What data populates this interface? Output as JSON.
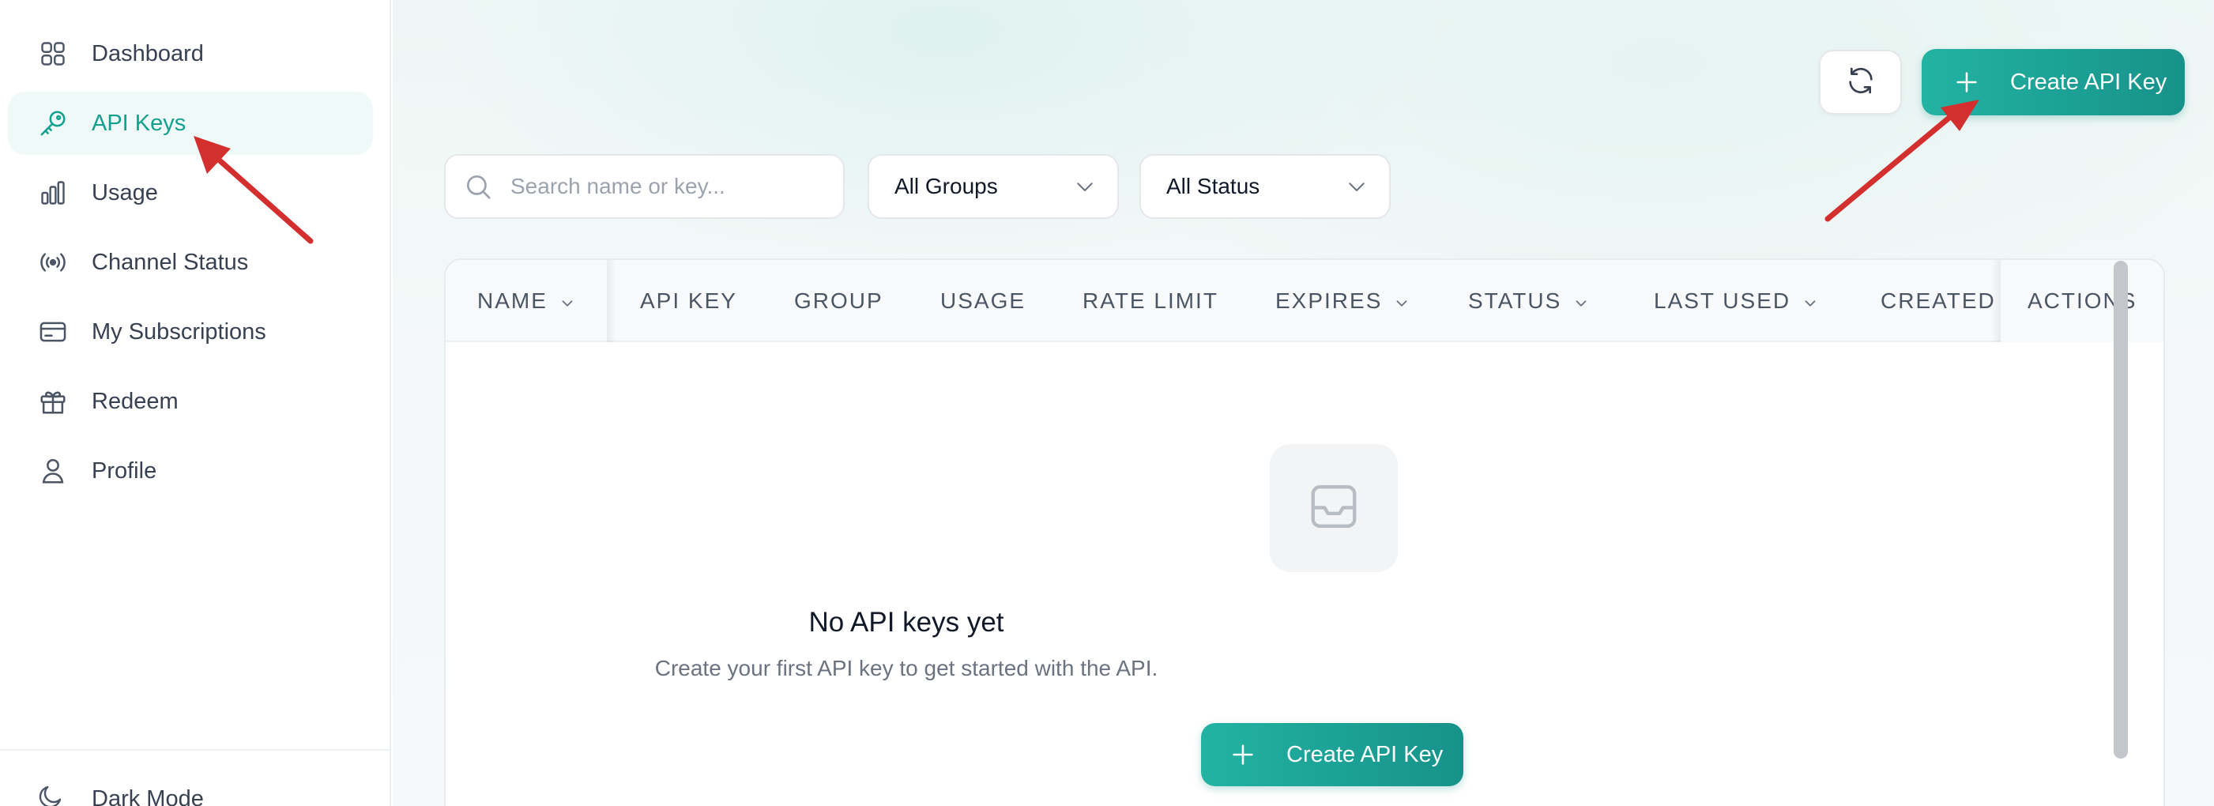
{
  "sidebar": {
    "items": [
      {
        "label": "Dashboard",
        "icon": "grid-icon"
      },
      {
        "label": "API Keys",
        "icon": "key-icon",
        "active": true
      },
      {
        "label": "Usage",
        "icon": "bar-chart-icon"
      },
      {
        "label": "Channel Status",
        "icon": "broadcast-icon"
      },
      {
        "label": "My Subscriptions",
        "icon": "credit-card-icon"
      },
      {
        "label": "Redeem",
        "icon": "gift-icon"
      },
      {
        "label": "Profile",
        "icon": "user-icon"
      }
    ],
    "dark_mode_label": "Dark Mode"
  },
  "toolbar": {
    "create_label": "Create API Key",
    "refresh_icon": "refresh-icon"
  },
  "filters": {
    "search_placeholder": "Search name or key...",
    "group_selected": "All Groups",
    "status_selected": "All Status"
  },
  "table": {
    "columns": [
      {
        "label": "NAME",
        "sortable": true
      },
      {
        "label": "API KEY",
        "sortable": false
      },
      {
        "label": "GROUP",
        "sortable": false
      },
      {
        "label": "USAGE",
        "sortable": false
      },
      {
        "label": "RATE LIMIT",
        "sortable": false
      },
      {
        "label": "EXPIRES",
        "sortable": true
      },
      {
        "label": "STATUS",
        "sortable": true
      },
      {
        "label": "LAST USED",
        "sortable": true
      },
      {
        "label": "CREATED",
        "sortable": false
      },
      {
        "label": "ACTIONS",
        "sortable": false
      }
    ]
  },
  "empty_state": {
    "icon": "inbox-icon",
    "title": "No API keys yet",
    "subtitle": "Create your first API key to get started with the API.",
    "button_label": "Create API Key"
  },
  "colors": {
    "accent": "#14a08f",
    "accent_bg": "#effaf8",
    "button_gradient_start": "#22b3a3",
    "button_gradient_end": "#17928a",
    "annotation_arrow": "#d32f2f"
  }
}
